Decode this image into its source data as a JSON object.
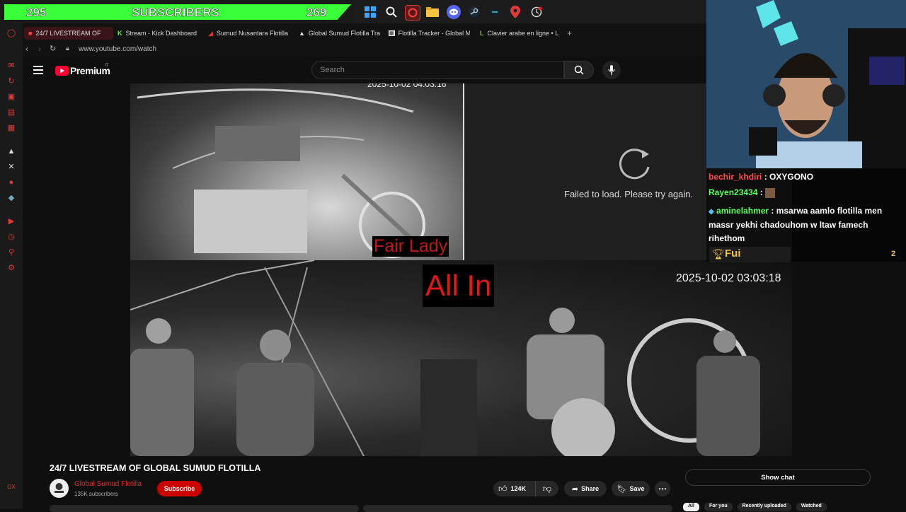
{
  "overlay": {
    "sub_count_left": "295",
    "sub_label": "SUBSCRIBERS",
    "sub_count_right": "269"
  },
  "tabs": [
    {
      "label": "24/7 LIVESTREAM OF"
    },
    {
      "label": "Stream - Kick Dashboard"
    },
    {
      "label": "Sumud Nusantara Flotilla"
    },
    {
      "label": "Global Sumud Flotilla Tra"
    },
    {
      "label": "Flotilla Tracker - Global M"
    },
    {
      "label": "Clavier arabe en ligne • L"
    }
  ],
  "address": {
    "url": "www.youtube.com/watch"
  },
  "youtube": {
    "logo_text": "Premium",
    "region": "IT",
    "search_placeholder": "Search"
  },
  "video": {
    "timestamp_top": "2025-10-02 04:03:16",
    "boat_name_1": "Fair Lady",
    "failed_text": "Failed to load. Please try again.",
    "boat_name_2": "All In",
    "timestamp_bottom": "2025-10-02 03:03:18"
  },
  "chat": {
    "messages": [
      {
        "user": "bechir_khdiri",
        "text": "OXYGONO"
      },
      {
        "user": "Rayen23434",
        "text": ""
      },
      {
        "user": "aminelahmer",
        "text": "msarwa aamlo flotilla men massr yekhi chadouhom w ltaw famech rihethom"
      }
    ],
    "goal_label": "Fui",
    "goal_count": "2"
  },
  "meta": {
    "title": "24/7 LIVESTREAM OF GLOBAL SUMUD FLOTILLA",
    "channel": "Global Sumud Flotilla",
    "subscribers": "135K subscribers",
    "subscribe_label": "Subscribe",
    "likes": "124K",
    "share_label": "Share",
    "save_label": "Save",
    "show_chat_label": "Show chat",
    "chips": [
      "All",
      "For you",
      "Recently uploaded",
      "Watched"
    ]
  },
  "colors": {
    "accent_red": "#ff0033",
    "sub_green": "#3cff3c",
    "user_red": "#ff4d4d",
    "user_green": "#59ff59"
  }
}
